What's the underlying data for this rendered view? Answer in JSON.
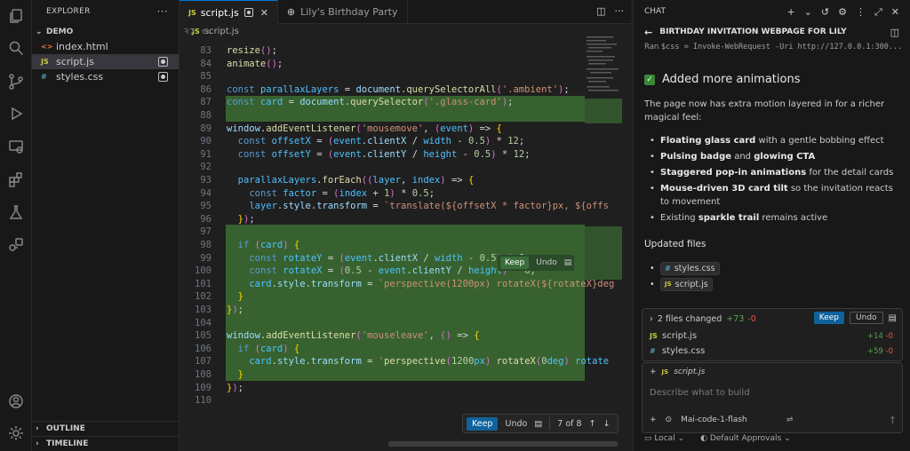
{
  "explorer": {
    "title": "EXPLORER",
    "folder": "DEMO",
    "files": [
      {
        "icon": "<>",
        "name": "index.html",
        "color": "#e37933"
      },
      {
        "icon": "JS",
        "name": "script.js",
        "color": "#cbcb41"
      },
      {
        "icon": "#",
        "name": "styles.css",
        "color": "#519aba"
      }
    ],
    "outline": "OUTLINE",
    "timeline": "TIMELINE"
  },
  "tabs": {
    "active": "script.js",
    "other": "Lily's Birthday Party"
  },
  "breadcrumb": "script.js",
  "code": {
    "top_partial": "32.js",
    "lines": [
      {
        "n": "83",
        "t": "resize();"
      },
      {
        "n": "84",
        "t": "animate();"
      },
      {
        "n": "85",
        "t": ""
      },
      {
        "n": "86",
        "t": "const parallaxLayers = document.querySelectorAll('.ambient');"
      },
      {
        "n": "87",
        "t": "const card = document.querySelector('.glass-card');"
      },
      {
        "n": "88",
        "t": ""
      },
      {
        "n": "89",
        "t": "window.addEventListener('mousemove', (event) => {"
      },
      {
        "n": "90",
        "t": "  const offsetX = (event.clientX / width - 0.5) * 12;"
      },
      {
        "n": "91",
        "t": "  const offsetY = (event.clientY / height - 0.5) * 12;"
      },
      {
        "n": "92",
        "t": ""
      },
      {
        "n": "93",
        "t": "  parallaxLayers.forEach((layer, index) => {"
      },
      {
        "n": "94",
        "t": "    const factor = (index + 1) * 0.5;"
      },
      {
        "n": "95",
        "t": "    layer.style.transform = `translate(${offsetX * factor}px, ${offs"
      },
      {
        "n": "96",
        "t": "  });"
      },
      {
        "n": "97",
        "t": ""
      },
      {
        "n": "98",
        "t": "  if (card) {"
      },
      {
        "n": "99",
        "t": "    const rotateY = (event.clientX / width - 0.5) * 8;"
      },
      {
        "n": "100",
        "t": "    const rotateX = (0.5 - event.clientY / height) * 6;"
      },
      {
        "n": "101",
        "t": "    card.style.transform = `perspective(1200px) rotateX(${rotateX}deg"
      },
      {
        "n": "102",
        "t": "  }"
      },
      {
        "n": "103",
        "t": "});"
      },
      {
        "n": "104",
        "t": ""
      },
      {
        "n": "105",
        "t": "window.addEventListener('mouseleave', () => {"
      },
      {
        "n": "106",
        "t": "  if (card) {"
      },
      {
        "n": "107",
        "t": "    card.style.transform = 'perspective(1200px) rotateX(0deg) rotate"
      },
      {
        "n": "108",
        "t": "  }"
      },
      {
        "n": "109",
        "t": "});"
      },
      {
        "n": "110",
        "t": ""
      }
    ],
    "inline_keep": "Keep",
    "inline_undo": "Undo"
  },
  "review": {
    "keep": "Keep",
    "undo": "Undo",
    "position": "7 of 8"
  },
  "chat": {
    "header": "CHAT",
    "title": "BIRTHDAY INVITATION WEBPAGE FOR LILY",
    "ran_label": "Ran",
    "ran_cmd": "$css = Invoke-WebRequest -Uri http://127.0.0.1:300...",
    "answer_heading": "Added more animations",
    "intro": "The page now has extra motion layered in for a richer magical feel:",
    "bullets": [
      {
        "bold": "Floating glass card",
        "rest": " with a gentle bobbing effect"
      },
      {
        "bold": "Pulsing badge",
        "mid": " and ",
        "bold2": "glowing CTA"
      },
      {
        "bold": "Staggered pop-in animations",
        "rest": " for the detail cards"
      },
      {
        "bold": "Mouse-driven 3D card tilt",
        "rest": " so the invitation reacts to movement"
      },
      {
        "pre": "Existing ",
        "bold": "sparkle trail",
        "rest": " remains active"
      }
    ],
    "updated_heading": "Updated files",
    "updated_files": [
      "styles.css",
      "script.js"
    ],
    "changes": {
      "summary": "2 files changed",
      "plus": "+73",
      "minus": "-0",
      "keep": "Keep",
      "undo": "Undo",
      "files": [
        {
          "type": "JS",
          "name": "script.js",
          "plus": "+14",
          "minus": "-0"
        },
        {
          "type": "#",
          "name": "styles.css",
          "plus": "+59",
          "minus": "-0"
        }
      ]
    },
    "context_file": "script.js",
    "input_placeholder": "Describe what to build",
    "model": "Mai-code-1-flash",
    "footer_local": "Local",
    "footer_approvals": "Default Approvals"
  }
}
